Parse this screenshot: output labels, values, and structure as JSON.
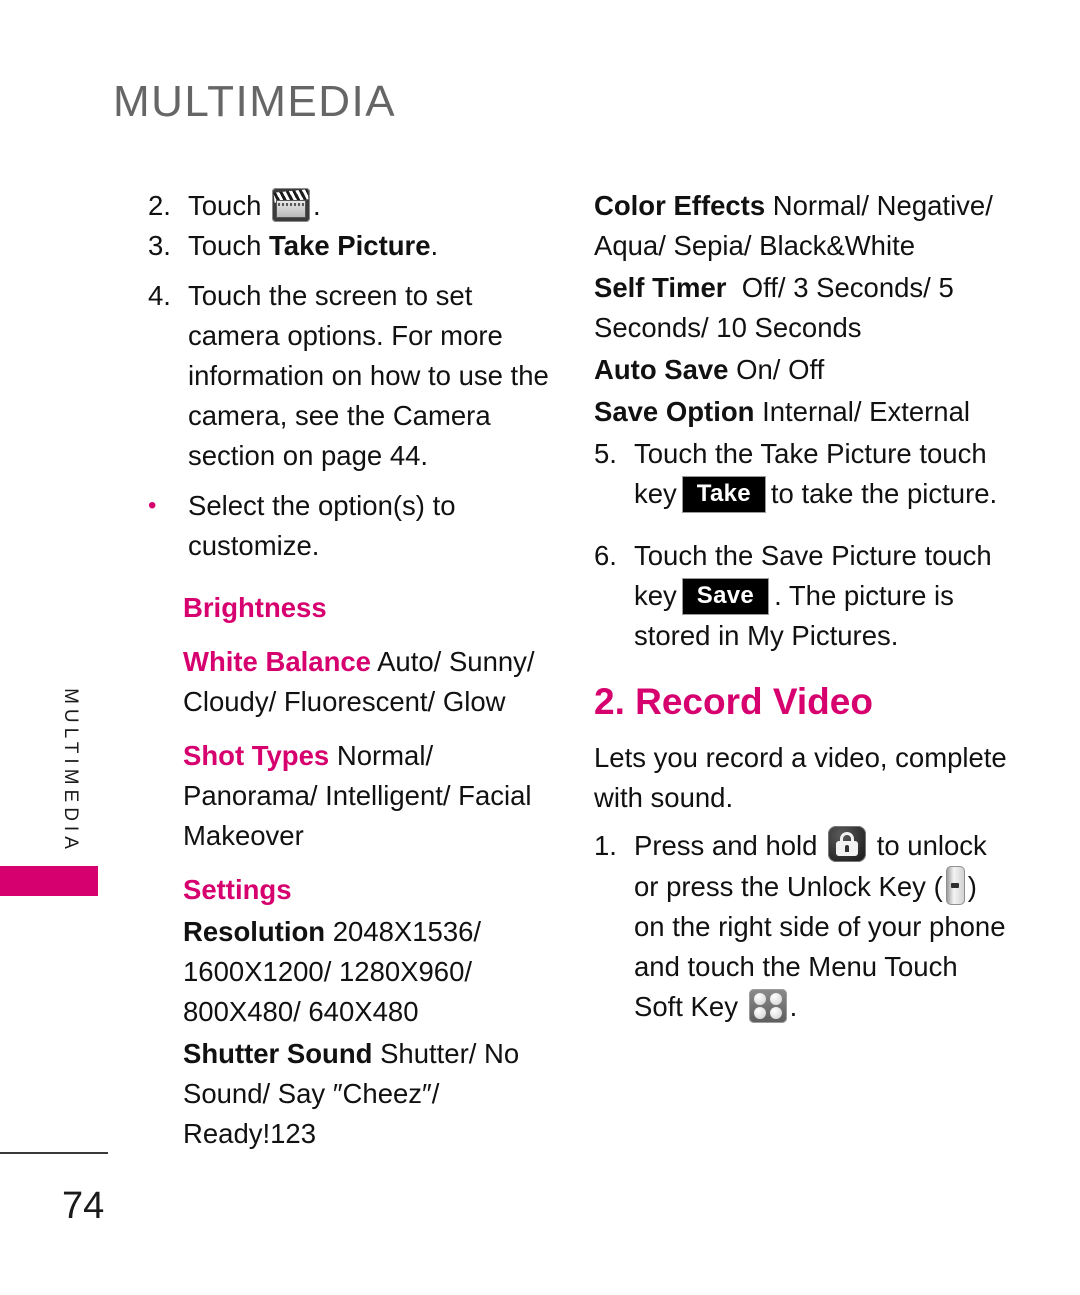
{
  "page": {
    "title": "MULTIMEDIA",
    "side_tab_label": "MULTIMEDIA",
    "page_number": "74",
    "accent_color": "#d6006e",
    "title_color": "#666666"
  },
  "left_column": {
    "steps": [
      {
        "marker": "2.",
        "before": "Touch",
        "icon": "clapperboard-icon",
        "after": "."
      },
      {
        "marker": "3.",
        "text_plain": "Touch ",
        "text_bold": "Take Picture",
        "text_tail": "."
      },
      {
        "marker": "4.",
        "text": "Touch the screen to set camera options. For more information on how to use the camera, see the Camera section on page 44."
      },
      {
        "marker": "•",
        "text": "Select the option(s) to customize."
      }
    ],
    "options": [
      {
        "name": "Brightness",
        "name_color": "pink",
        "values": ""
      },
      {
        "name": "White Balance",
        "name_color": "pink",
        "values": "Auto/ Sunny/ Cloudy/ Fluorescent/ Glow"
      },
      {
        "name": "Shot Types",
        "name_color": "pink",
        "values": "Normal/ Panorama/ Intelligent/ Facial Makeover"
      },
      {
        "name": "Settings",
        "name_color": "pink",
        "values": ""
      },
      {
        "name": "Resolution",
        "name_color": "black",
        "values": "2048X1536/ 1600X1200/ 1280X960/ 800X480/ 640X480"
      },
      {
        "name": "Shutter Sound",
        "name_color": "black",
        "values": "Shutter/ No Sound/ Say ″Cheez″/ Ready!123"
      }
    ]
  },
  "right_column": {
    "options": [
      {
        "name": "Color Effects",
        "values": "Normal/ Negative/ Aqua/ Sepia/ Black&White"
      },
      {
        "name": "Self Timer",
        "values": "Off/ 3 Seconds/ 5 Seconds/ 10 Seconds"
      },
      {
        "name": "Auto Save",
        "values": "On/ Off"
      },
      {
        "name": "Save Option",
        "values": "Internal/ External"
      }
    ],
    "steps": [
      {
        "marker": "5.",
        "part1": "Touch the Take Picture touch key",
        "badge": "Take",
        "part2": "to take the picture."
      },
      {
        "marker": "6.",
        "part1": "Touch the Save Picture touch key",
        "badge": "Save",
        "part2": ". The picture is stored in My Pictures."
      }
    ],
    "section": {
      "heading": "2. Record Video",
      "intro": "Lets you record a video, complete with sound.",
      "step": {
        "marker": "1.",
        "part1": "Press and hold",
        "icon1": "lock-icon",
        "part2": "to unlock or press the Unlock Key (",
        "icon2": "side-unlock-key-icon",
        "part3": ") on the right side of your phone and touch the Menu Touch Soft Key",
        "icon3": "menu-touch-soft-key-icon",
        "part4": "."
      }
    }
  }
}
